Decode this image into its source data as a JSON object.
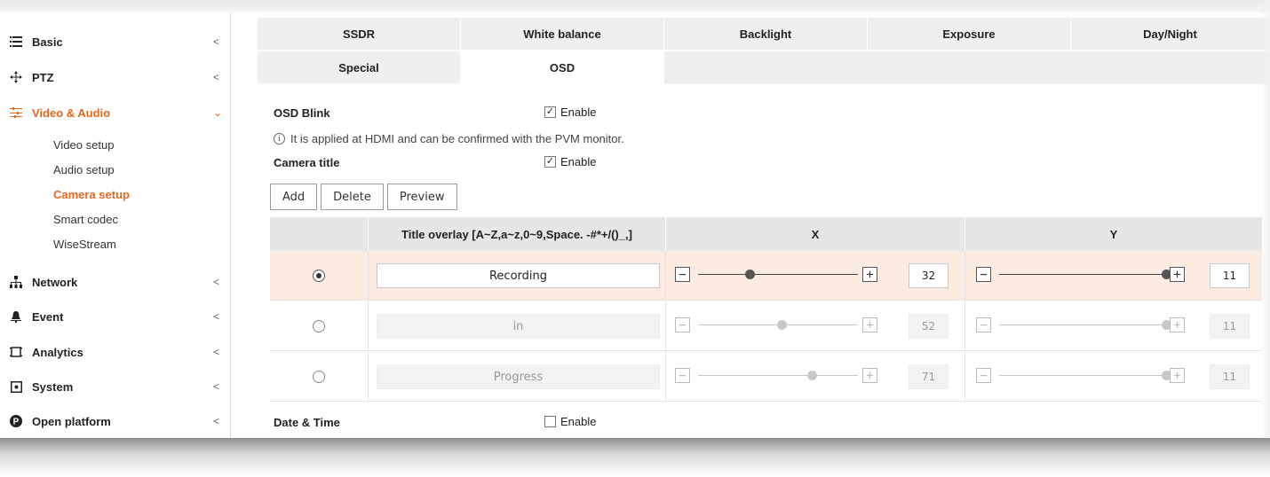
{
  "sidebar": {
    "menu": [
      {
        "label": "Basic",
        "icon": "list-icon"
      },
      {
        "label": "PTZ",
        "icon": "move-icon"
      },
      {
        "label": "Video & Audio",
        "icon": "sliders-icon"
      },
      {
        "label": "Network",
        "icon": "network-icon"
      },
      {
        "label": "Event",
        "icon": "bell-icon"
      },
      {
        "label": "Analytics",
        "icon": "frame-icon"
      },
      {
        "label": "System",
        "icon": "system-icon"
      },
      {
        "label": "Open platform",
        "icon": "p-circle-icon"
      }
    ],
    "sub_items": [
      "Video setup",
      "Audio setup",
      "Camera setup",
      "Smart codec",
      "WiseStream"
    ],
    "active_menu": "Video & Audio",
    "active_sub": "Camera setup",
    "accent_color": "#e8671e"
  },
  "tabs": {
    "row1": [
      "SSDR",
      "White balance",
      "Backlight",
      "Exposure",
      "Day/Night"
    ],
    "row2": [
      "Special",
      "OSD"
    ],
    "active": "OSD"
  },
  "osd_blink": {
    "label": "OSD Blink",
    "enable_label": "Enable",
    "checked": true
  },
  "info_text": "It is applied at HDMI and can be confirmed with the PVM monitor.",
  "camera_title": {
    "label": "Camera title",
    "enable_label": "Enable",
    "checked": true
  },
  "buttons": {
    "add": "Add",
    "delete": "Delete",
    "preview": "Preview"
  },
  "table": {
    "headers": {
      "select": "",
      "title": "Title overlay [A~Z,a~z,0~9,Space. -#*+/()_,]",
      "x": "X",
      "y": "Y"
    },
    "rows": [
      {
        "title": "Recording",
        "x": 32,
        "y": 11,
        "selected": true
      },
      {
        "title": "in",
        "x": 52,
        "y": 11,
        "selected": false
      },
      {
        "title": "Progress",
        "x": 71,
        "y": 11,
        "selected": false
      }
    ],
    "x_range": [
      0,
      100
    ],
    "y_range": [
      0,
      11
    ]
  },
  "date_time": {
    "label": "Date & Time",
    "enable_label": "Enable",
    "checked": false
  }
}
